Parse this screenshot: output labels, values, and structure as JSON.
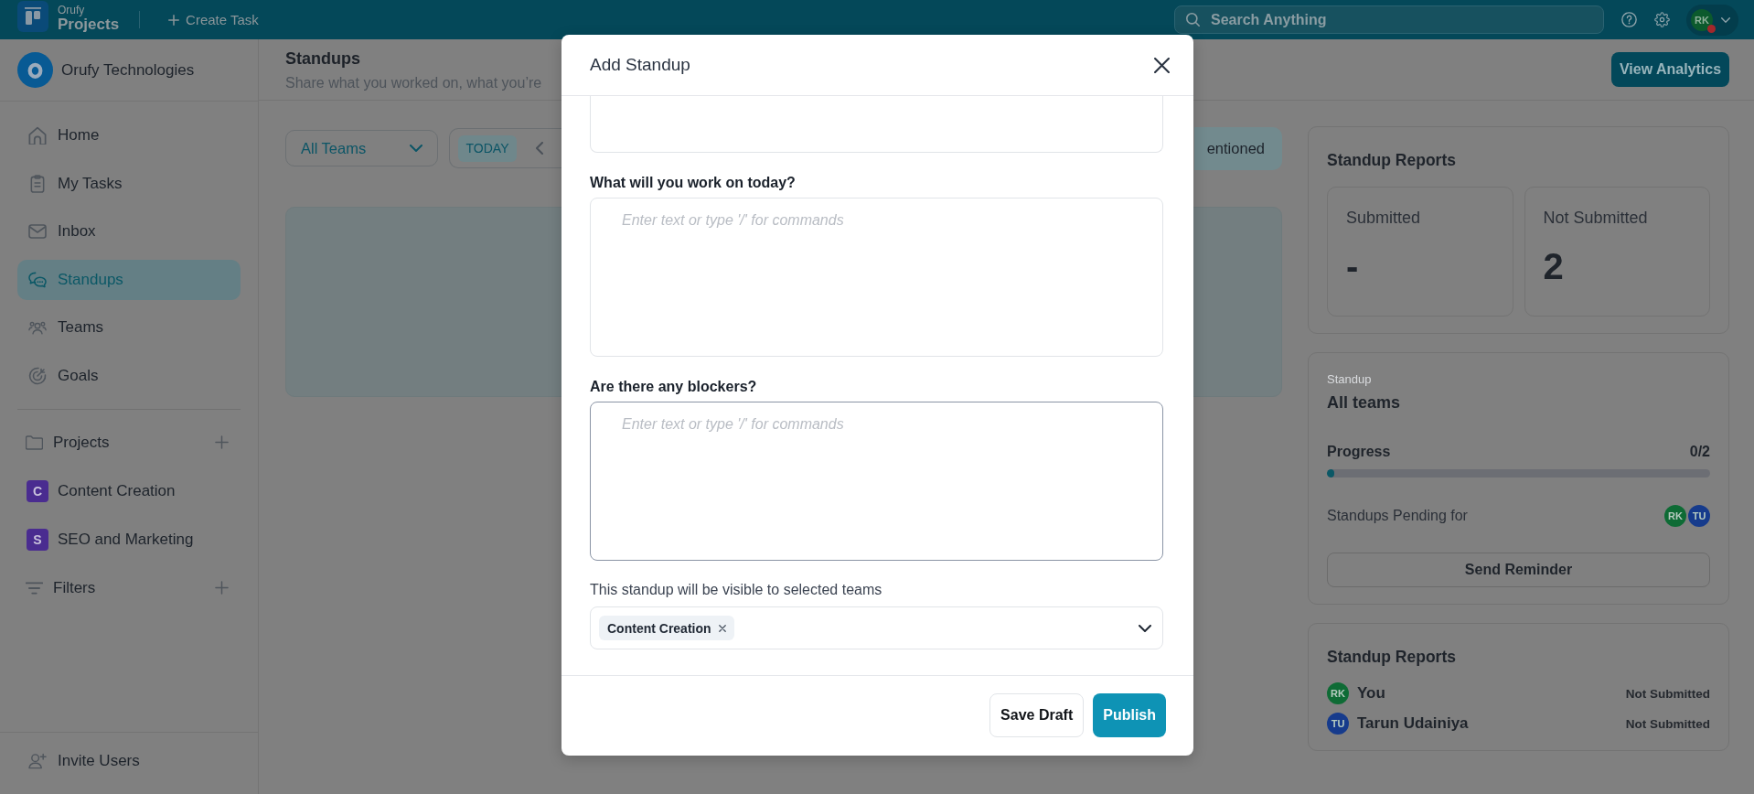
{
  "top_bar": {
    "app_label": "Orufy",
    "app_name": "Projects",
    "create_task": "Create Task",
    "search": {
      "placeholder": "Search Anything"
    },
    "user": {
      "initials": "RK",
      "color": "#0c5a2d",
      "notification": true
    }
  },
  "sidebar": {
    "workspace": "Orufy Technologies",
    "nav": [
      {
        "label": "Home",
        "selected": false
      },
      {
        "label": "My Tasks",
        "selected": false
      },
      {
        "label": "Inbox",
        "selected": false
      },
      {
        "label": "Standups",
        "selected": true
      },
      {
        "label": "Teams",
        "selected": false
      },
      {
        "label": "Goals",
        "selected": false
      }
    ],
    "projects": {
      "label": "Projects",
      "items": [
        {
          "initial": "C",
          "name": "Content Creation"
        },
        {
          "initial": "S",
          "name": "SEO and Marketing"
        }
      ]
    },
    "filters": {
      "label": "Filters"
    },
    "invite": "Invite Users"
  },
  "page": {
    "title": "Standups",
    "subtitle": "Share what you worked on, what you’re",
    "action": "View Analytics",
    "team_filter": "All Teams",
    "date_chip": "TODAY",
    "view_tab": "entioned"
  },
  "right_panel": {
    "reports": {
      "title": "Standup Reports",
      "stats": [
        {
          "label": "Submitted",
          "value": "-"
        },
        {
          "label": "Not Submitted",
          "value": "2"
        }
      ]
    },
    "summary": {
      "caption": "Standup",
      "title": "All teams",
      "progress": {
        "label": "Progress",
        "reading": "0/2",
        "level": 0
      },
      "pending_label": "Standups Pending for",
      "pending": [
        {
          "initials": "RK",
          "color": "#0e6b35"
        },
        {
          "initials": "TU",
          "color": "#163b8c"
        }
      ],
      "reminder": "Send Reminder"
    },
    "statuses": {
      "title": "Standup Reports",
      "rows": [
        {
          "initials": "RK",
          "color": "#0e6b35",
          "name": "You",
          "status": "Not Submitted"
        },
        {
          "initials": "TU",
          "color": "#163b8c",
          "name": "Tarun Udainiya",
          "status": "Not Submitted"
        }
      ]
    }
  },
  "modal": {
    "title": "Add Standup",
    "fields": [
      {
        "kind": "partial",
        "focused": false
      },
      {
        "kind": "editor",
        "label": "What will you work on today?",
        "placeholder": "Enter text or type '/' for commands",
        "focused": false
      },
      {
        "kind": "editor",
        "label": "Are there any blockers?",
        "placeholder": "Enter text or type '/' for commands",
        "focused": true
      }
    ],
    "visibility": {
      "label": "This standup will be visible to selected teams",
      "chips": [
        "Content Creation"
      ]
    },
    "buttons": [
      {
        "label": "Save Draft",
        "kind": "secondary"
      },
      {
        "label": "Publish",
        "kind": "primary"
      }
    ]
  }
}
